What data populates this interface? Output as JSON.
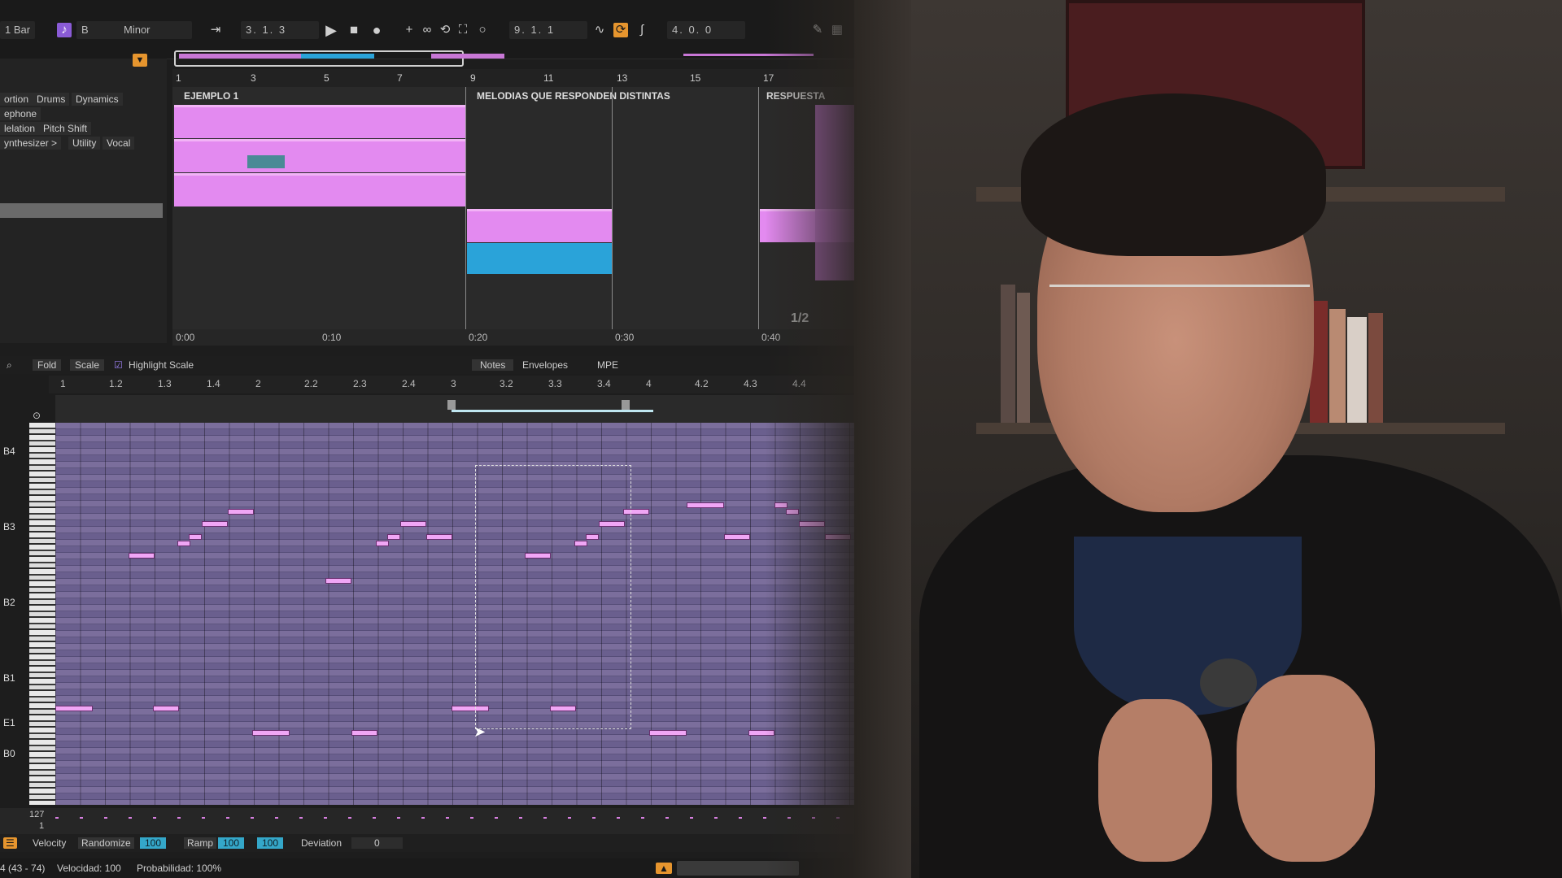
{
  "transport": {
    "quantize": "1 Bar",
    "scale_root": "B",
    "scale_mode": "Minor",
    "position": "3.  1.  3",
    "loop_start": "9.  1.  1",
    "loop_length": "4.  0.  0"
  },
  "device_tags": [
    "ortion",
    "Drums",
    "Dynamics",
    "ephone",
    "lelation",
    "Pitch Shift",
    "ynthesizer >",
    "Utility",
    "Vocal"
  ],
  "arrangement": {
    "bar_ticks": [
      "1",
      "3",
      "5",
      "7",
      "9",
      "11",
      "13",
      "15",
      "17"
    ],
    "sections": [
      "EJEMPLO 1",
      "MELODIAS QUE RESPONDEN DISTINTAS",
      "RESPUESTA"
    ],
    "time_ticks": [
      "0:00",
      "0:10",
      "0:20",
      "0:30",
      "0:40"
    ],
    "page_indicator": "1/2"
  },
  "piano_roll": {
    "toolbar": {
      "fold": "Fold",
      "scale": "Scale",
      "highlight_scale": "Highlight Scale"
    },
    "tabs": [
      "Notes",
      "Envelopes",
      "MPE"
    ],
    "beat_ticks": [
      "1",
      "1.2",
      "1.3",
      "1.4",
      "2",
      "2.2",
      "2.3",
      "2.4",
      "3",
      "3.2",
      "3.3",
      "3.4",
      "4",
      "4.2",
      "4.3",
      "4.4"
    ],
    "key_labels": [
      "B4",
      "B3",
      "B2",
      "B1",
      "E1",
      "B0"
    ],
    "velocity_max": "127",
    "velocity_min": "1"
  },
  "velocity_bar": {
    "label": "Velocity",
    "randomize": "Randomize",
    "randomize_value": "100",
    "ramp": "Ramp",
    "ramp_a": "100",
    "ramp_b": "100",
    "deviation": "Deviation",
    "deviation_value": "0"
  },
  "status": {
    "range": "4 (43 - 74)",
    "velocity": "Velocidad: 100",
    "probability": "Probabilidad: 100%"
  }
}
